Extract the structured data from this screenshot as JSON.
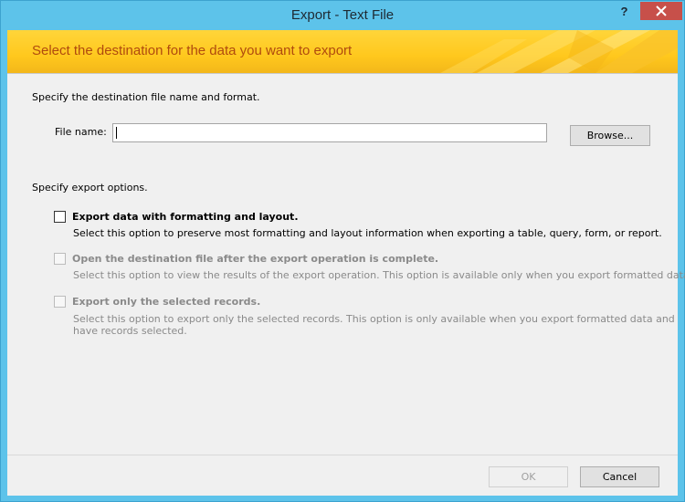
{
  "window": {
    "title": "Export - Text File",
    "help_label": "?"
  },
  "banner": {
    "heading": "Select the destination for the data you want to export"
  },
  "destination": {
    "section_label": "Specify the destination file name and format.",
    "file_name_label": "File name:",
    "file_name_value": "",
    "browse_label": "Browse..."
  },
  "options": {
    "section_label": "Specify export options.",
    "items": [
      {
        "label": "Export data with formatting and layout.",
        "description": "Select this option to preserve most formatting and layout information when exporting a table, query, form, or report.",
        "checked": false,
        "enabled": true
      },
      {
        "label": "Open the destination file after the export operation is complete.",
        "description": "Select this option to view the results of the export operation. This option is available only when you export formatted data.",
        "checked": false,
        "enabled": false
      },
      {
        "label": "Export only the selected records.",
        "description_line1": "Select this option to export only the selected records. This option is only available when you export formatted data and",
        "description_line2": "have records selected.",
        "checked": false,
        "enabled": false
      }
    ]
  },
  "footer": {
    "ok_label": "OK",
    "cancel_label": "Cancel"
  },
  "colors": {
    "titlebar": "#5dc3ea",
    "close": "#c7504a",
    "banner": "#ffc81d",
    "banner_text": "#b04a0e"
  }
}
